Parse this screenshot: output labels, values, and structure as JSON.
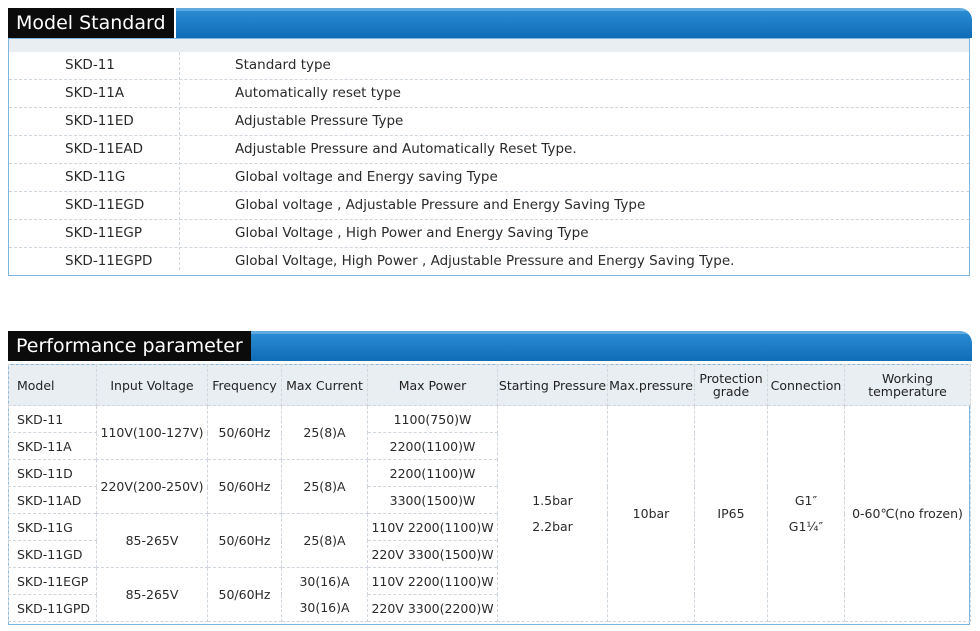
{
  "model_standard": {
    "title": "Model Standard",
    "rows": [
      {
        "code": "SKD-11",
        "desc": "Standard type"
      },
      {
        "code": "SKD-11A",
        "desc": "Automatically reset type"
      },
      {
        "code": "SKD-11ED",
        "desc": "Adjustable Pressure Type"
      },
      {
        "code": "SKD-11EAD",
        "desc": "Adjustable Pressure and Automatically Reset Type."
      },
      {
        "code": "SKD-11G",
        "desc": "Global voltage and Energy saving Type"
      },
      {
        "code": "SKD-11EGD",
        "desc": "Global voltage , Adjustable Pressure and Energy Saving Type"
      },
      {
        "code": "SKD-11EGP",
        "desc": "Global Voltage , High Power and Energy Saving Type"
      },
      {
        "code": "SKD-11EGPD",
        "desc": "Global Voltage, High Power , Adjustable Pressure and Energy Saving Type."
      }
    ]
  },
  "performance": {
    "title": "Performance parameter",
    "headers": {
      "model": "Model",
      "input_voltage": "Input Voltage",
      "frequency": "Frequency",
      "max_current": "Max Current",
      "max_power": "Max Power",
      "starting_pressure": "Starting Pressure",
      "max_pressure": "Max.pressure",
      "protection_grade_1": "Protection",
      "protection_grade_2": "grade",
      "connection": "Connection",
      "working_temp_1": "Working",
      "working_temp_2": "temperature"
    },
    "groups": [
      {
        "models": [
          "SKD-11",
          "SKD-11A"
        ],
        "input_voltage": "110V(100-127V)",
        "frequency": "50/60Hz",
        "current": [
          "25(8)A"
        ],
        "power": [
          "1100(750)W",
          "2200(1100)W"
        ]
      },
      {
        "models": [
          "SKD-11D",
          "SKD-11AD"
        ],
        "input_voltage": "220V(200-250V)",
        "frequency": "50/60Hz",
        "current": [
          "25(8)A"
        ],
        "power": [
          "2200(1100)W",
          "3300(1500)W"
        ]
      },
      {
        "models": [
          "SKD-11G",
          "SKD-11GD"
        ],
        "input_voltage": "85-265V",
        "frequency": "50/60Hz",
        "current": [
          "25(8)A"
        ],
        "power": [
          "110V 2200(1100)W",
          "220V 3300(1500)W"
        ]
      },
      {
        "models": [
          "SKD-11EGP",
          "SKD-11GPD"
        ],
        "input_voltage": "85-265V",
        "frequency": "50/60Hz",
        "current": [
          "30(16)A",
          "30(16)A"
        ],
        "power": [
          "110V 2200(1100)W",
          "220V 3300(2200)W"
        ]
      }
    ],
    "shared": {
      "starting_pressure": [
        "1.5bar",
        "2.2bar"
      ],
      "max_pressure": "10bar",
      "protection": "IP65",
      "connection": [
        "G1″",
        "G1¼″"
      ],
      "temperature": "0-60℃(no frozen)"
    }
  }
}
